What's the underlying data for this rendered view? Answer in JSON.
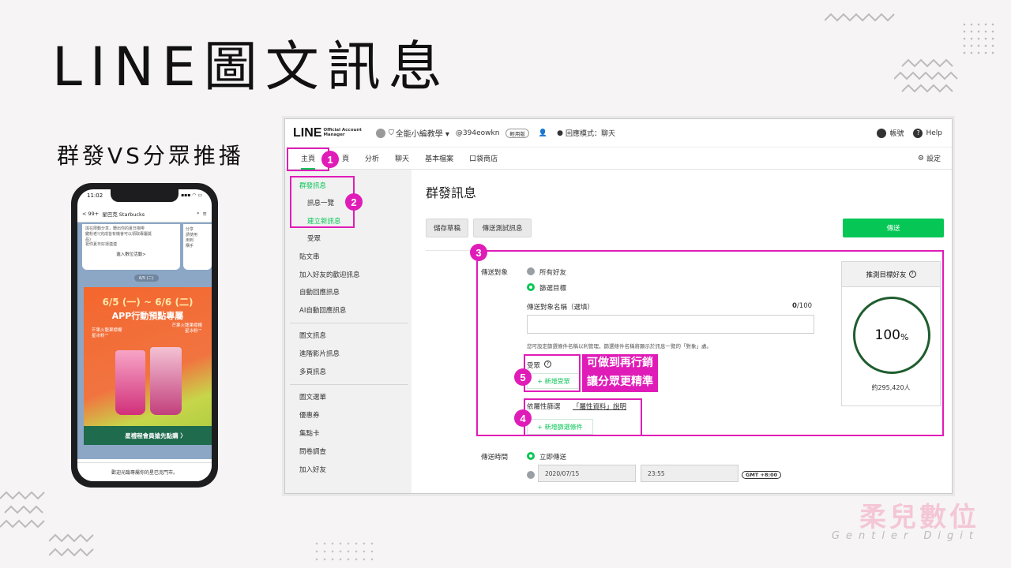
{
  "slide": {
    "title": "LINE圖文訊息",
    "subtitle": "群發VS分眾推播",
    "brand": "柔兒數位",
    "brand_en": "Gentler  Digit"
  },
  "phone": {
    "time": "11:02",
    "signal": "▪▪▪ ◠ ▭",
    "back_label": "< 99+",
    "chat_name": "星巴克 Starbucks",
    "card_text": "與在限動分享，轉出你的夏日咖啡\n鍵粉老!(完成皆有機會可以領取專屬獎\n品)\n祝你夏日好運連連",
    "card_link": "進入數位活動>",
    "card2_text": "分享\n請使用\n用到\n購手",
    "date_chip": "6/5 (二)",
    "banner_date": "6/5 (一) ~ 6/6 (二)",
    "banner_headline": "APP行動預點專屬",
    "banner_left": "芒果火龍果檸檬\n星冰粉™",
    "banner_right": "芒果火龍果檸檬\n星冰粉™",
    "member_text": "星禮程會員搶先點購 〉",
    "footer_text": "歡迎光臨專屬你的星巴克門市。"
  },
  "screenshot": {
    "topbar": {
      "logo": "LINE",
      "logo_sub": "Official Account\nManager",
      "account_name": "全能小編教學 ▾",
      "account_id": "@394eowkn",
      "plan_badge": "輕用版",
      "reply_mode": "回應模式：聊天",
      "account_label": "帳號",
      "help_label": "Help"
    },
    "nav": {
      "items": [
        "主頁",
        "分析",
        "聊天",
        "基本檔案",
        "口袋商店"
      ],
      "hidden_item": "頁",
      "settings": "設定"
    },
    "sidebar": {
      "broadcast": "群發訊息",
      "message_list": "訊息一覽",
      "create_new": "建立新訊息",
      "audience": "受眾",
      "timeline": "貼文串",
      "greeting": "加入好友的歡迎訊息",
      "auto_reply": "自動回應訊息",
      "ai_reply": "AI自動回應訊息",
      "rich_message": "圖文訊息",
      "rich_video": "進階影片訊息",
      "card_message": "多頁訊息",
      "rich_menu": "圖文選單",
      "coupon": "優惠券",
      "reward_card": "集點卡",
      "survey": "問卷調查",
      "add_friend": "加入好友"
    },
    "main": {
      "page_title": "群發訊息",
      "save_draft": "儲存草稿",
      "send_test": "傳送測試訊息",
      "send": "傳送",
      "recipient_label": "傳送對象",
      "all_friends": "所有好友",
      "filter_target": "篩選目標",
      "target_name_label": "傳送對象名稱（選填）",
      "target_name_count": "0",
      "target_name_max": "/100",
      "target_name_value": "",
      "hint": "您可設定篩選條件名稱以利管理，篩選條件名稱將顯示於訊息一覽的「對象」處。",
      "audience_label": "受眾",
      "add_audience": "+ 新增受眾",
      "attribute_filter_label": "依屬性篩選",
      "attribute_link": "「屬性資料」說明",
      "add_filter": "+ 新增篩選條件",
      "send_time_label": "傳送時間",
      "send_now": "立即傳送",
      "date_value": "2020/07/15",
      "time_value": "23:55",
      "timezone": "GMT +8:00",
      "predicted_label": "推測目標好友",
      "predicted_percent": "100",
      "predicted_percent_unit": "%",
      "predicted_count": "約295,420人"
    },
    "annotations": {
      "n1": "1",
      "n2": "2",
      "n3": "3",
      "n4": "4",
      "n5": "5",
      "callout_line1": "可做到再行銷",
      "callout_line2": "讓分眾更精準"
    }
  },
  "colors": {
    "line_green": "#06c755",
    "annotation_magenta": "#e01cb8",
    "gauge_ring": "#1f5d2e"
  }
}
